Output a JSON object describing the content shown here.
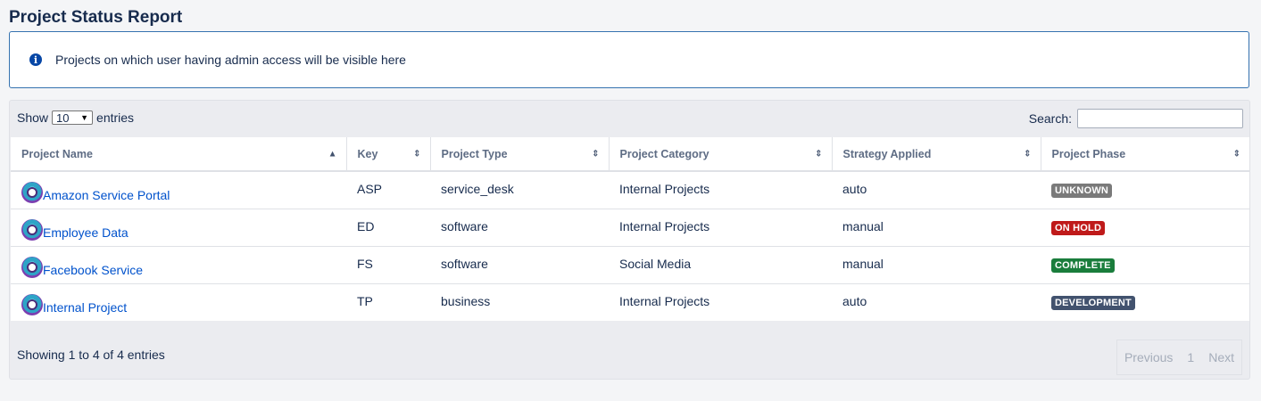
{
  "page": {
    "title": "Project Status Report",
    "info_message": "Projects on which user having admin access will be visible here"
  },
  "controls": {
    "show_label": "Show",
    "entries_label": "entries",
    "length_value": "10",
    "search_label": "Search:",
    "search_value": ""
  },
  "table": {
    "headers": [
      "Project Name",
      "Key",
      "Project Type",
      "Project Category",
      "Strategy Applied",
      "Project Phase"
    ],
    "rows": [
      {
        "name": "Amazon Service Portal",
        "key": "ASP",
        "type": "service_desk",
        "category": "Internal Projects",
        "strategy": "auto",
        "phase": "UNKNOWN",
        "phase_color": "#7a7a7a"
      },
      {
        "name": "Employee Data",
        "key": "ED",
        "type": "software",
        "category": "Internal Projects",
        "strategy": "manual",
        "phase": "ON HOLD",
        "phase_color": "#bf1a1a"
      },
      {
        "name": "Facebook Service",
        "key": "FS",
        "type": "software",
        "category": "Social Media",
        "strategy": "manual",
        "phase": "COMPLETE",
        "phase_color": "#1a7d3c"
      },
      {
        "name": "Internal Project",
        "key": "TP",
        "type": "business",
        "category": "Internal Projects",
        "strategy": "auto",
        "phase": "DEVELOPMENT",
        "phase_color": "#42526e"
      }
    ]
  },
  "footer": {
    "info": "Showing 1 to 4 of 4 entries",
    "previous_label": "Previous",
    "current_page": "1",
    "next_label": "Next"
  },
  "icons": {
    "info": "info-icon",
    "sort_asc": "sort-asc-icon",
    "sort_both": "sort-both-icon",
    "avatar": "project-avatar-icon",
    "dropdown": "caret-down-icon"
  },
  "colors": {
    "accent": "#0052cc",
    "info_border": "#3572b0"
  }
}
